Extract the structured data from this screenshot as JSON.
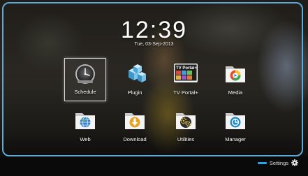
{
  "clock": {
    "time": "12:39",
    "date": "Tue, 03-Sep-2013"
  },
  "menu": {
    "selected": "Schedule",
    "items": [
      {
        "label": "Schedule",
        "icon": "clock-icon"
      },
      {
        "label": "Plugin",
        "icon": "blocks-icon"
      },
      {
        "label": "TV Portal+",
        "icon": "tv-portal-icon",
        "badge": "TV Portal+"
      },
      {
        "label": "Media",
        "icon": "media-player-icon"
      },
      {
        "label": "Web",
        "icon": "globe-icon"
      },
      {
        "label": "Download",
        "icon": "download-icon"
      },
      {
        "label": "Utilities",
        "icon": "gears-icon"
      },
      {
        "label": "Manager",
        "icon": "manager-icon"
      }
    ]
  },
  "footer": {
    "settings_label": "Settings",
    "settings_icon": "gear-icon",
    "accent": "#29a4e6"
  },
  "colors": {
    "frame": "#5fa9d9",
    "accent": "#29a4e6"
  }
}
